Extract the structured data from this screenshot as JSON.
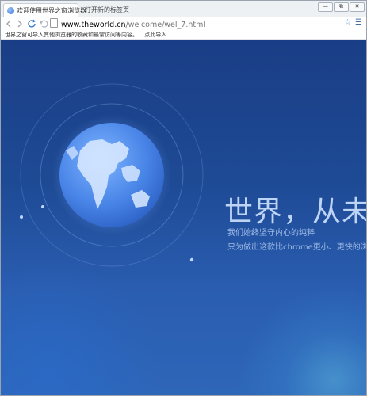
{
  "tabs": [
    {
      "label": "欢迎使用世界之窗浏览器",
      "active": true
    },
    {
      "label": "打开新的标签页",
      "active": false
    }
  ],
  "window_buttons": [
    "—",
    "⧉",
    "✕"
  ],
  "toolbar": {
    "back_icon": "back-arrow-icon",
    "forward_icon": "forward-arrow-icon",
    "refresh_icon": "refresh-icon",
    "undo_icon": "undo-icon",
    "url_domain": "www.theworld.cn",
    "url_path": "/welcome/wel_7.html"
  },
  "infobar": {
    "message": "世界之窗可导入其他浏览器的收藏和最常访问等内容。",
    "link": "点此导入"
  },
  "hero": {
    "headline": "世界，从未这",
    "line1": "我们始终坚守内心的纯粹",
    "line2": "只为做出这款比chrome更小、更快的浏"
  },
  "colors": {
    "accent": "#4a90d9",
    "background_top": "#1a3e86",
    "background_bottom": "#2e66b8"
  }
}
